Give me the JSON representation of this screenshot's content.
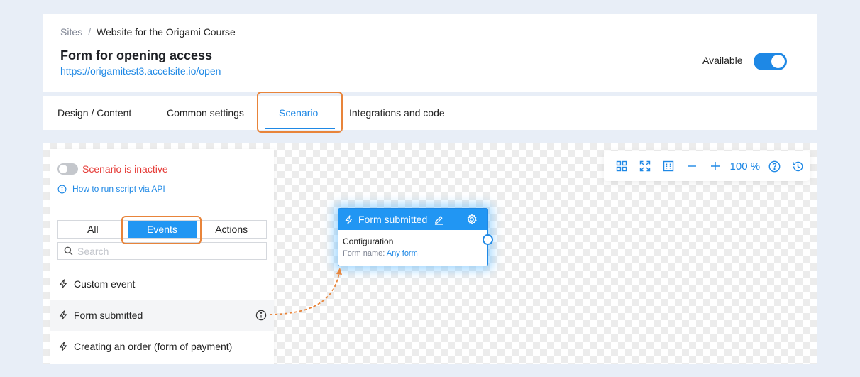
{
  "breadcrumb": {
    "root": "Sites",
    "separator": "/",
    "current": "Website for the Origami Course"
  },
  "page": {
    "title": "Form for opening access",
    "url": "https://origamitest3.accelsite.io/open"
  },
  "availability": {
    "label": "Available",
    "enabled": true
  },
  "tabs": [
    {
      "label": "Design / Content",
      "active": false
    },
    {
      "label": "Common settings",
      "active": false
    },
    {
      "label": "Scenario",
      "active": true
    },
    {
      "label": "Integrations and code",
      "active": false
    }
  ],
  "toolbar": {
    "icons": [
      "grid-icon",
      "fit-screen-icon",
      "frame-icon",
      "zoom-out-icon",
      "zoom-in-icon",
      "help-icon",
      "history-icon"
    ],
    "zoom": "100 %"
  },
  "scenario_panel": {
    "status_enabled": false,
    "status_text": "Scenario is inactive",
    "api_link": "How to run script via API",
    "filters": [
      {
        "label": "All",
        "active": false
      },
      {
        "label": "Events",
        "active": true
      },
      {
        "label": "Actions",
        "active": false
      }
    ],
    "search_placeholder": "Search",
    "events": [
      {
        "label": "Custom event"
      },
      {
        "label": "Form submitted"
      },
      {
        "label": "Creating an order (form of payment)"
      }
    ]
  },
  "node": {
    "title": "Form submitted",
    "config_label": "Configuration",
    "form_name_label": "Form name:",
    "form_name_value": "Any form"
  },
  "colors": {
    "accent": "#1e88e5",
    "highlight": "#e8843a",
    "inactive": "#e53935"
  }
}
